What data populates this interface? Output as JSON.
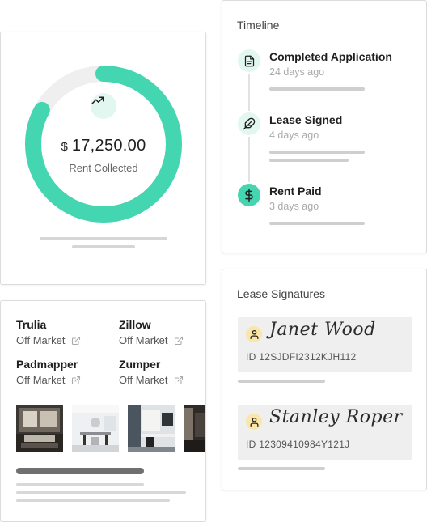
{
  "rent": {
    "currency": "$",
    "amount": "17,250.00",
    "label": "Rent Collected",
    "progress": 0.83,
    "accent": "#43d6b0",
    "track": "#efefef",
    "icon": "trending-up-icon"
  },
  "listings": [
    {
      "name": "Trulia",
      "status": "Off Market",
      "icon": "external-link-icon"
    },
    {
      "name": "Zillow",
      "status": "Off Market",
      "icon": "external-link-icon"
    },
    {
      "name": "Padmapper",
      "status": "Off Market",
      "icon": "external-link-icon"
    },
    {
      "name": "Zumper",
      "status": "Off Market",
      "icon": "external-link-icon"
    }
  ],
  "photos": [
    "photo-living-room",
    "photo-dining-room",
    "photo-office",
    "photo-interior"
  ],
  "timeline": {
    "title": "Timeline",
    "events": [
      {
        "title": "Completed Application",
        "time": "24 days ago",
        "icon": "document-icon"
      },
      {
        "title": "Lease Signed",
        "time": "4 days ago",
        "icon": "feather-icon"
      },
      {
        "title": "Rent Paid",
        "time": "3 days ago",
        "icon": "dollar-icon"
      }
    ]
  },
  "signatures": {
    "title": "Lease Signatures",
    "items": [
      {
        "name": "Janet Wood",
        "id_label": "ID",
        "id": "12SJDFI2312KJH112",
        "icon": "user-icon"
      },
      {
        "name": "Stanley Roper",
        "id_label": "ID",
        "id": "12309410984Y121J",
        "icon": "user-icon"
      }
    ]
  }
}
